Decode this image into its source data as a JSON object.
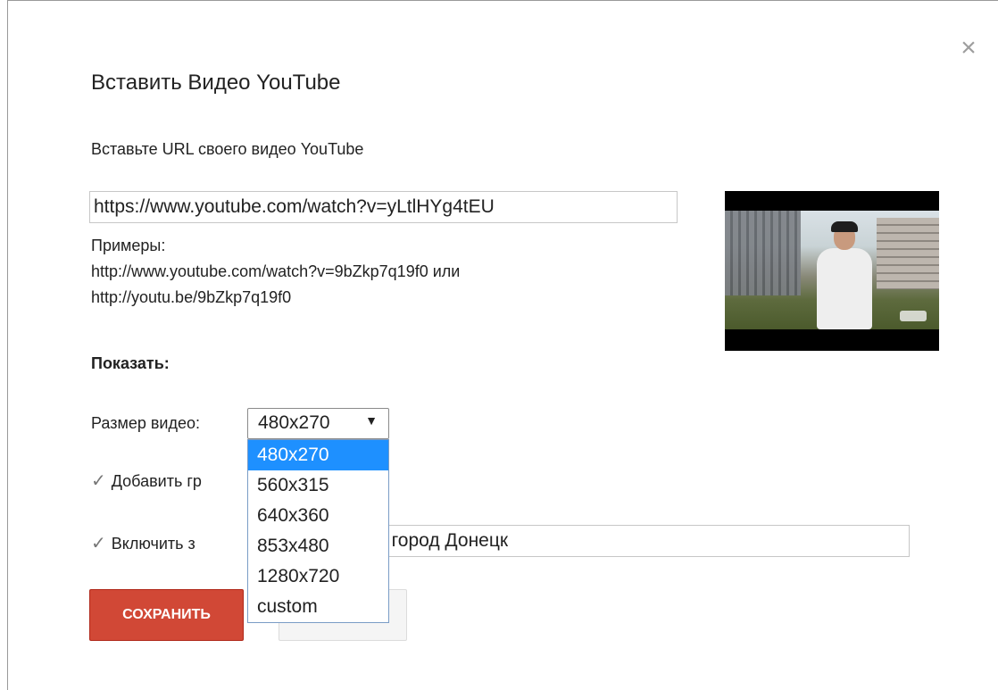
{
  "dialog": {
    "title": "Вставить Видео YouTube",
    "close_glyph": "×",
    "url_label": "Вставьте URL своего видео YouTube",
    "url_value": "https://www.youtube.com/watch?v=yLtlHYg4tEU",
    "examples": {
      "label": "Примеры:",
      "line1": "http://www.youtube.com/watch?v=9bZkp7q19f0 или",
      "line2": "http://youtu.be/9bZkp7q19f0"
    },
    "show_heading": "Показать:",
    "size_label": "Размер видео:",
    "size_select": {
      "selected": "480x270",
      "options": [
        "480x270",
        "560x315",
        "640x360",
        "853x480",
        "1280x720",
        "custom"
      ]
    },
    "checkbox_border": {
      "label": "Добавить гр",
      "checked": true
    },
    "checkbox_title": {
      "label": "Включить з",
      "checked": true,
      "input_value": "й город Донецк"
    },
    "save_button": "СОХРАНИТЬ",
    "cancel_button": ""
  },
  "icons": {
    "close": "close-icon",
    "check": "checkmark-icon",
    "dropdown": "triangle-down-icon"
  },
  "colors": {
    "save_bg": "#d14836",
    "selected_option_bg": "#1e90ff",
    "dropdown_border": "#7a9cc6"
  }
}
